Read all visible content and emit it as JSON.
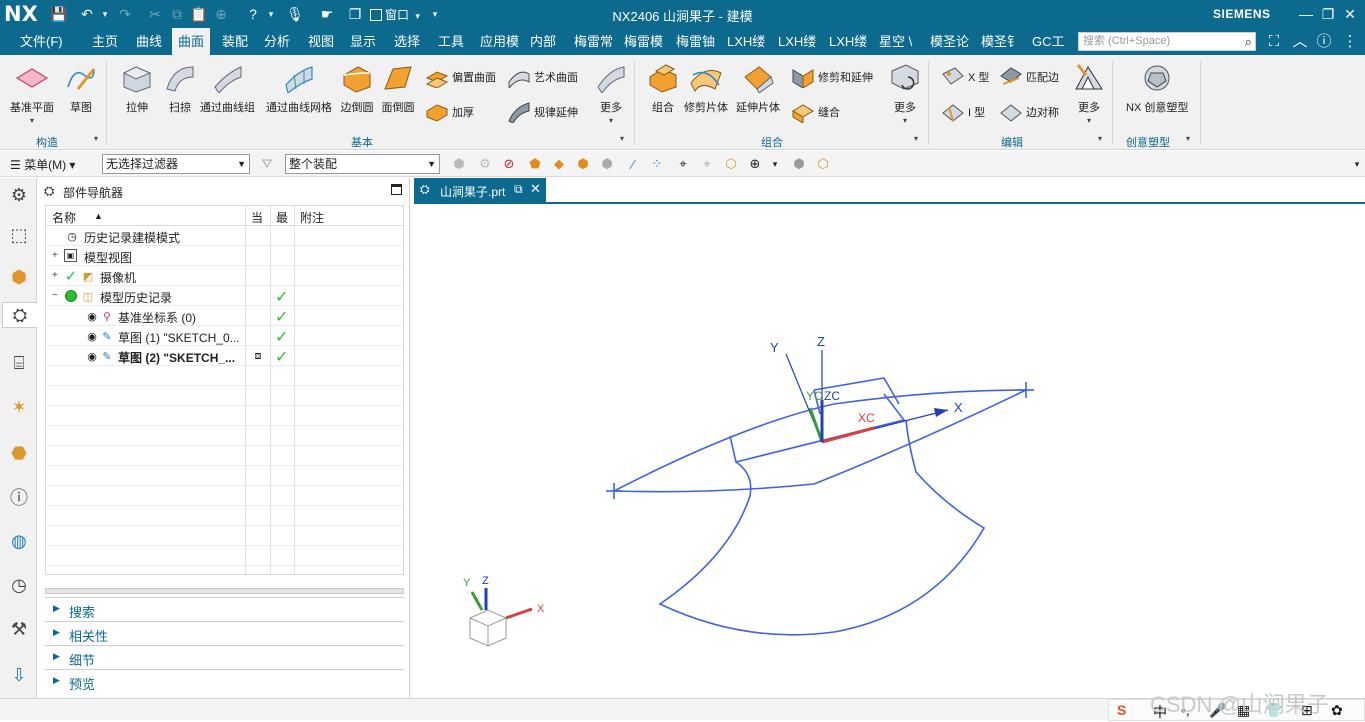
{
  "app": {
    "logo": "NX",
    "title": "NX2406 山涧果子 - 建模",
    "brand": "SIEMENS",
    "window_menu": "窗口",
    "window_menu_caret": "▾"
  },
  "tabs": [
    "文件(F)",
    "主页",
    "曲线",
    "曲面",
    "装配",
    "分析",
    "视图",
    "显示",
    "选择",
    "工具",
    "应用模",
    "内部",
    "梅雷常",
    "梅雷模",
    "梅雷铀",
    "LXH缕",
    "LXH缕",
    "LXH缕",
    "星空 \\",
    "模圣论",
    "模圣钅",
    "GC工"
  ],
  "active_tab": "曲面",
  "search": {
    "placeholder": "搜索 (Ctrl+Space)"
  },
  "ribbon": {
    "buttons": {
      "datum_plane": "基准平面",
      "sketch": "草图",
      "extrude": "拉伸",
      "sweep": "扫掠",
      "through_curves": "通过曲线组",
      "through_curve_mesh": "通过曲线网格",
      "edge_blend": "边倒圆",
      "face_blend": "面倒圆",
      "offset_surface": "偏置曲面",
      "thicken": "加厚",
      "studio_surface": "艺术曲面",
      "law_extension": "规律延伸",
      "more1": "更多",
      "unite": "组合",
      "trim_sheet": "修剪片体",
      "extend_sheet": "延伸片体",
      "trim_extend": "修剪和延伸",
      "sew": "缝合",
      "more2": "更多",
      "x_type": "X 型",
      "i_type": "I 型",
      "match_edge": "匹配边",
      "edge_symmetry": "边对称",
      "more3": "更多",
      "nx_realize": "NX 创意塑型"
    },
    "groups": {
      "construct": "构造",
      "basic": "基本",
      "combine": "组合",
      "edit": "编辑",
      "realize": "创意塑型"
    }
  },
  "selection_bar": {
    "menu": "菜单(M) ▾",
    "filter": "无选择过滤器",
    "scope": "整个装配"
  },
  "navigator": {
    "title": "部件导航器",
    "columns": {
      "name": "名称",
      "sort": "▲",
      "current": "当",
      "latest": "最",
      "notes": "附注"
    },
    "rows": [
      {
        "label": "历史记录建模模式",
        "expander": "",
        "checked": "",
        "bold": false
      },
      {
        "label": "模型视图",
        "expander": "+",
        "checked": "",
        "bold": false
      },
      {
        "label": "摄像机",
        "expander": "+",
        "checked": "",
        "bold": false
      },
      {
        "label": "模型历史记录",
        "expander": "−",
        "checked": "✓",
        "bold": false
      },
      {
        "label": "基准坐标系 (0)",
        "expander": "",
        "checked": "✓",
        "bold": false
      },
      {
        "label": "草图 (1) \"SKETCH_0...",
        "expander": "",
        "checked": "✓",
        "bold": false
      },
      {
        "label": "草图 (2) \"SKETCH_...",
        "expander": "",
        "checked": "✓",
        "bold": true
      }
    ],
    "panels": [
      "搜索",
      "相关性",
      "细节",
      "预览"
    ]
  },
  "document_tab": {
    "name": "山涧果子.prt"
  },
  "viewport": {
    "axis_labels": {
      "x": "X",
      "y": "Y",
      "z": "Z",
      "xc": "XC",
      "yc": "YC",
      "zc": "ZC"
    },
    "triad_labels": {
      "x": "X",
      "y": "Y",
      "z": "Z"
    },
    "curve_color": "#3f63e4",
    "axis_colors": {
      "x": "#d94040",
      "y": "#3e9a3e",
      "z": "#1f3fbf"
    }
  },
  "status": {
    "watermark": "CSDN @山涧果子",
    "tray": [
      "S",
      "中",
      "•,",
      "🎤",
      "▦",
      "👕",
      "⊞",
      "✿"
    ]
  }
}
